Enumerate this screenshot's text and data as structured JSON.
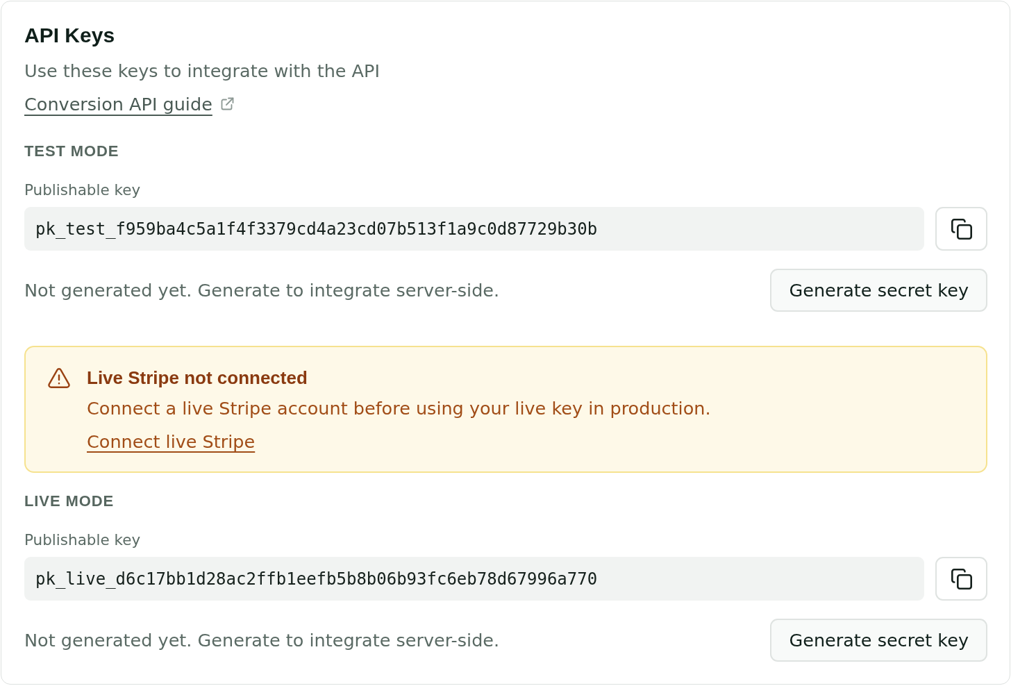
{
  "header": {
    "title": "API Keys",
    "subtitle": "Use these keys to integrate with the API",
    "guide_link": "Conversion API guide"
  },
  "sections": [
    {
      "kind": "keys",
      "heading": "TEST MODE",
      "key_label": "Publishable key",
      "key_value": "pk_test_f959ba4c5a1f4f3379cd4a23cd07b513f1a9c0d87729b30b",
      "secret_status": "Not generated yet. Generate to integrate server-side.",
      "secret_button": "Generate secret key"
    },
    {
      "kind": "alert",
      "title": "Live Stripe not connected",
      "message": "Connect a live Stripe account before using your live key in production.",
      "link": "Connect live Stripe"
    },
    {
      "kind": "keys",
      "heading": "LIVE MODE",
      "key_label": "Publishable key",
      "key_value": "pk_live_d6c17bb1d28ac2ffb1eefb5b8b06b93fc6eb78d67996a770",
      "secret_status": "Not generated yet. Generate to integrate server-side.",
      "secret_button": "Generate secret key"
    }
  ]
}
